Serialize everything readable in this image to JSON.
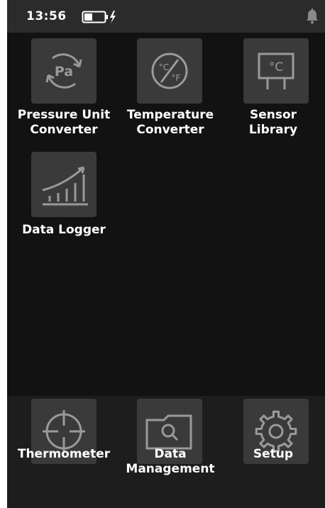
{
  "status_bar": {
    "time": "13:56",
    "icons": [
      "battery-charging-icon",
      "notification-bell-icon"
    ]
  },
  "apps": [
    {
      "id": "pressure",
      "label_line1": "Pressure Unit",
      "label_line2": "Converter",
      "icon": "pressure-pa-icon"
    },
    {
      "id": "temperature",
      "label_line1": "Temperature",
      "label_line2": "Converter",
      "icon": "temperature-conversion-icon"
    },
    {
      "id": "sensor",
      "label_line1": "Sensor",
      "label_line2": "Library",
      "icon": "sensor-celsius-icon"
    },
    {
      "id": "logger",
      "label_line1": "Data Logger",
      "label_line2": "",
      "icon": "bar-chart-trend-icon"
    }
  ],
  "dock": [
    {
      "id": "thermometer",
      "label_line1": "Thermometer",
      "label_line2": "",
      "icon": "crosshair-icon"
    },
    {
      "id": "data-management",
      "label_line1": "Data",
      "label_line2": "Management",
      "icon": "folder-search-icon"
    },
    {
      "id": "setup",
      "label_line1": "Setup",
      "label_line2": "",
      "icon": "gear-icon"
    }
  ],
  "colors": {
    "background": "#121212",
    "status_bar": "#2b2b2b",
    "tile": "#3a3a3a",
    "icon_stroke": "#9a9a9a",
    "dock": "#1d1d1d",
    "text": "#ffffff"
  }
}
